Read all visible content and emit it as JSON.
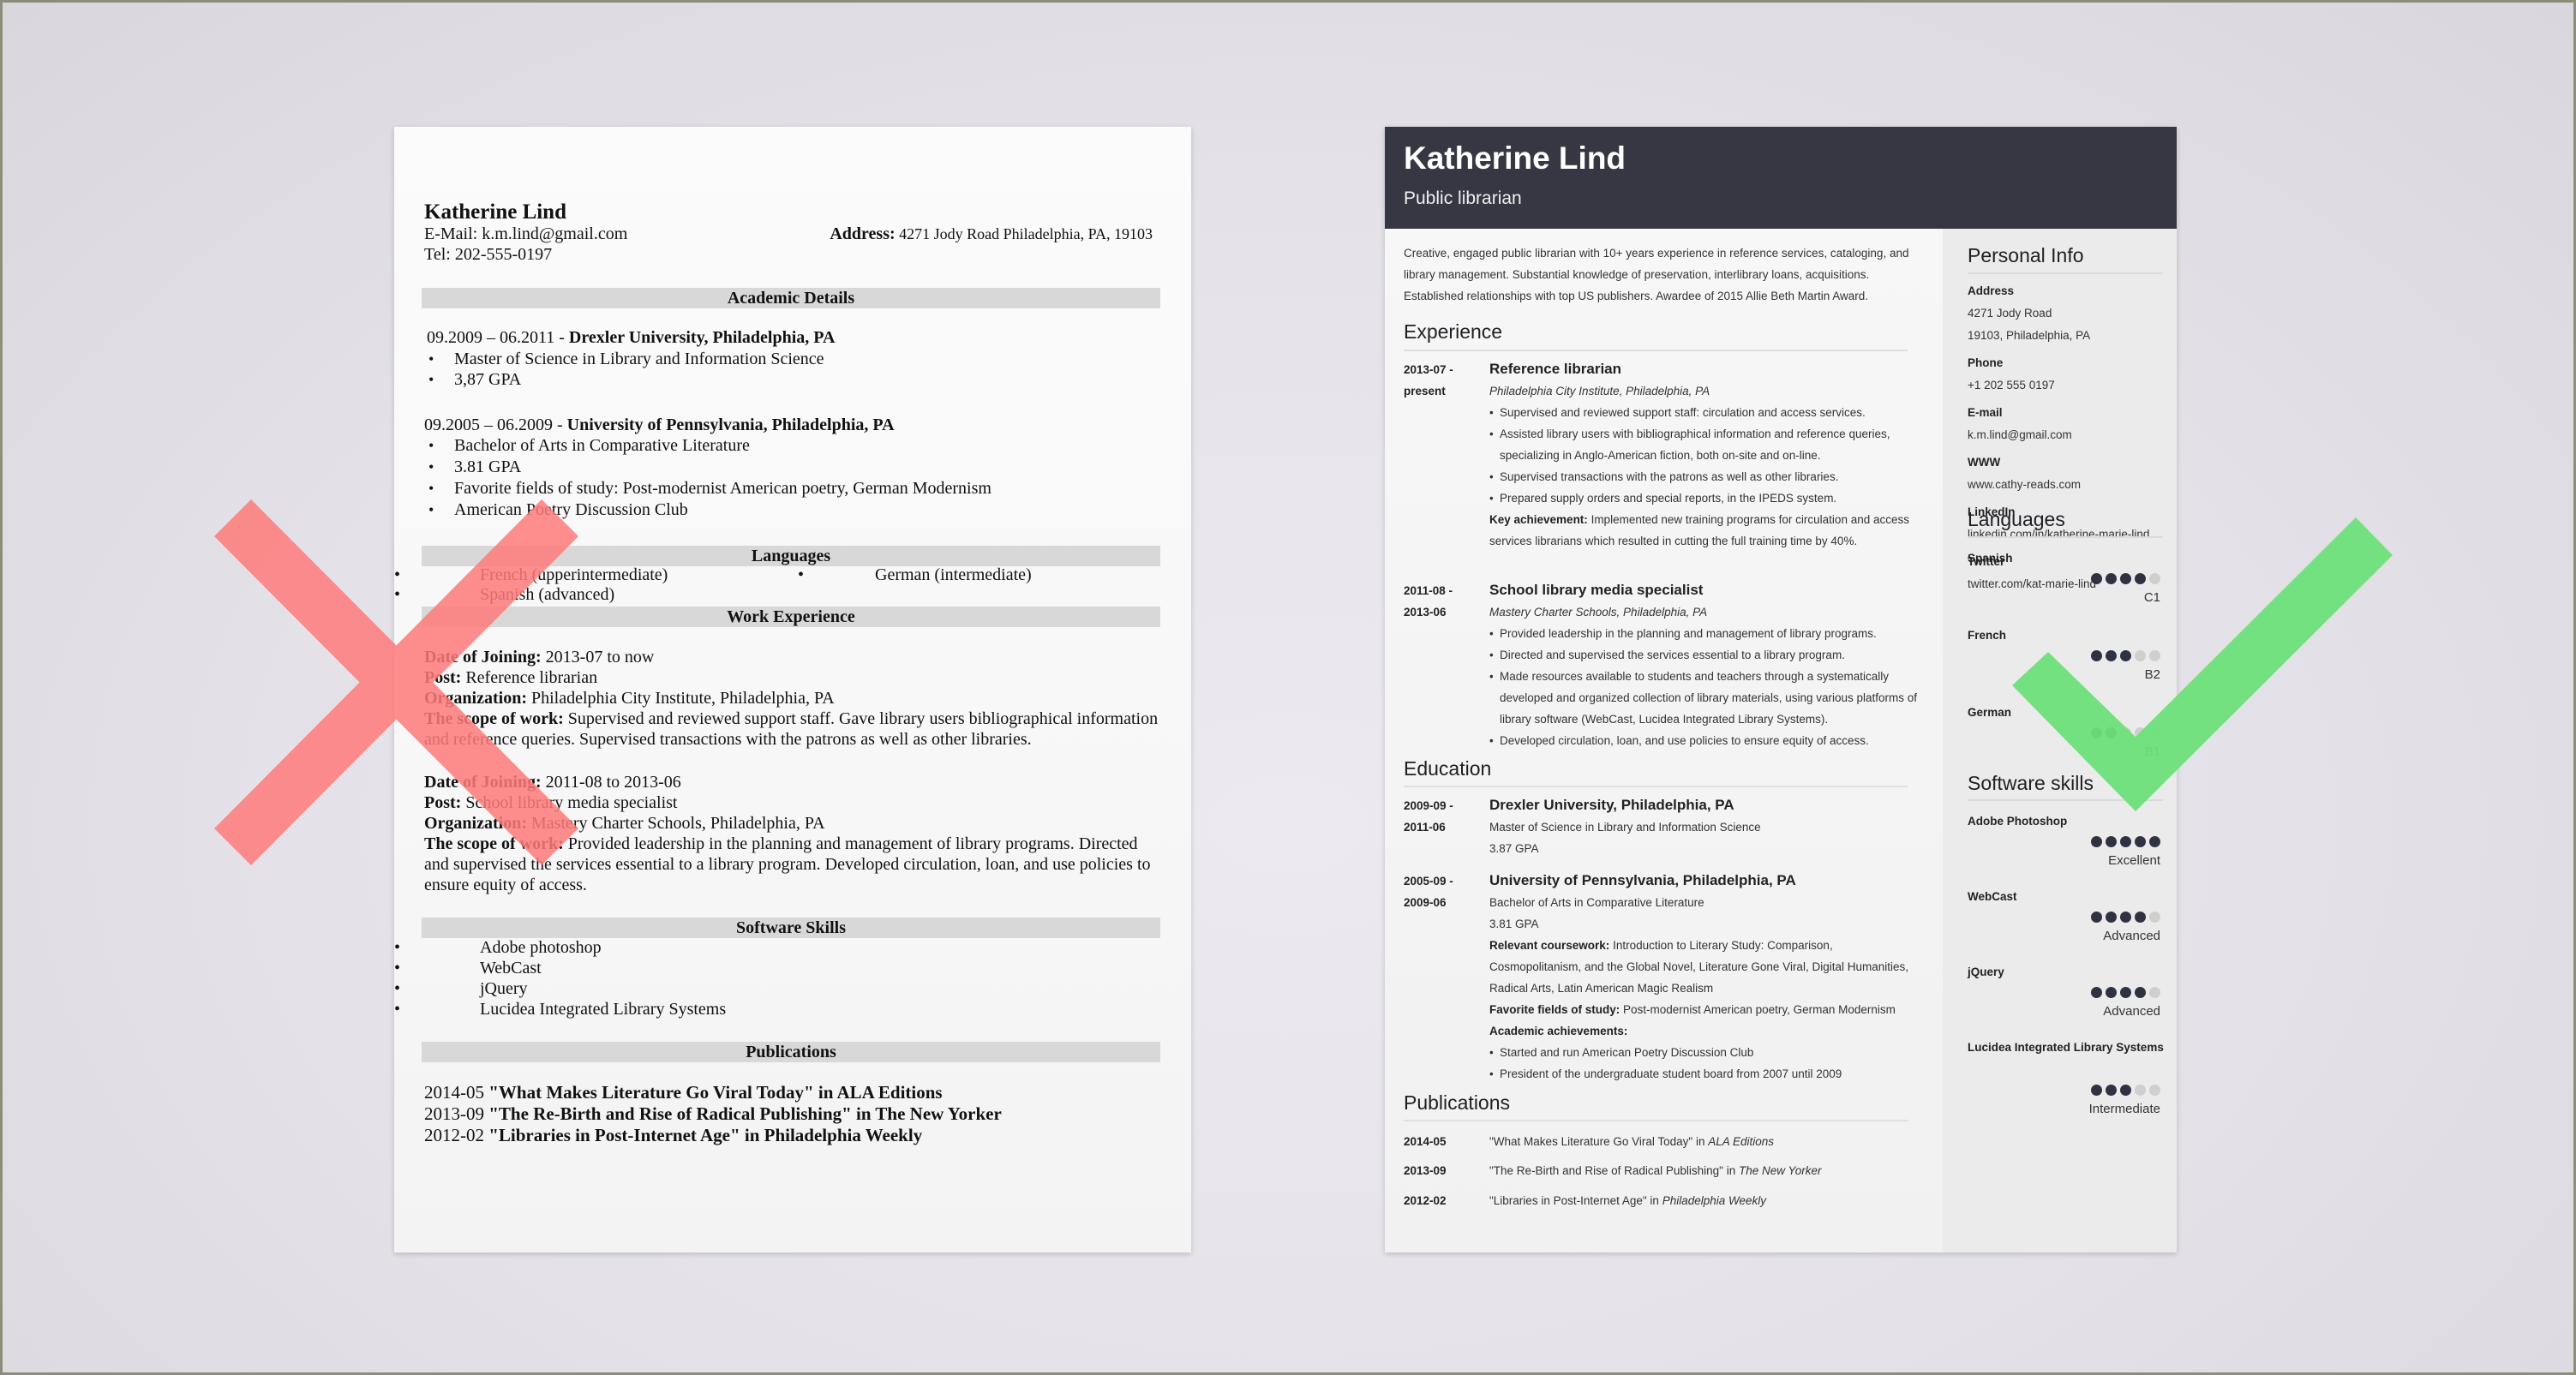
{
  "left_resume": {
    "name": "Katherine Lind",
    "email_label": "E-Mail:",
    "email": "k.m.lind@gmail.com",
    "address_label": "Address:",
    "address": "4271 Jody Road Philadelphia, PA, 19103",
    "tel_label": "Tel:",
    "tel": "202-555-0197",
    "sections": {
      "academic": "Academic Details",
      "languages": "Languages",
      "work": "Work Experience",
      "software": "Software Skills",
      "publications": "Publications"
    },
    "education": [
      {
        "dates": "09.2009 – 06.2011 - ",
        "school": "Drexler University, Philadelphia, PA",
        "items": [
          "Master of Science in Library and Information Science",
          "3,87 GPA"
        ]
      },
      {
        "dates": "09.2005 – 06.2009 - ",
        "school": "University of Pennsylvania, Philadelphia, PA",
        "items": [
          "Bachelor of Arts in Comparative Literature",
          "3.81 GPA",
          "Favorite fields of study: Post-modernist American poetry, German Modernism",
          "American Poetry Discussion Club"
        ]
      }
    ],
    "languages": [
      "French (upperintermediate)",
      "German (intermediate)",
      "Spanish (advanced)"
    ],
    "work": [
      {
        "date_label": "Date of Joining:",
        "date": " 2013-07 to now",
        "post_label": "Post:",
        "post": " Reference librarian",
        "org_label": "Organization:",
        "org": " Philadelphia City Institute, Philadelphia, PA",
        "scope_label": "The scope of work:",
        "scope": " Supervised and reviewed support staff. Gave library users bibliographical information and reference queries. Supervised transactions with the patrons as well as other libraries."
      },
      {
        "date_label": "Date of Joining:",
        "date": " 2011-08 to 2013-06",
        "post_label": "Post:",
        "post": " School library media specialist",
        "org_label": "Organization:",
        "org": " Mastery Charter Schools, Philadelphia, PA",
        "scope_label": "The scope of work:",
        "scope": " Provided leadership in the planning and management of library programs. Directed and supervised the services essential to a library program. Developed circulation, loan, and use policies to ensure equity of access."
      }
    ],
    "software": [
      "Adobe photoshop",
      "WebCast",
      "jQuery",
      "Lucidea Integrated Library Systems"
    ],
    "publications": [
      {
        "date": "2014-05 ",
        "title": "\"What Makes Literature Go Viral Today\" in ALA Editions"
      },
      {
        "date": "2013-09 ",
        "title": "\"The Re-Birth and Rise of Radical Publishing\" in The New Yorker"
      },
      {
        "date": "2012-02 ",
        "title": "\"Libraries in Post-Internet Age\" in Philadelphia Weekly"
      }
    ],
    "verdict_icon": "cross-icon",
    "verdict_color": "#ff7b7b"
  },
  "right_resume": {
    "name": "Katherine Lind",
    "title": "Public librarian",
    "header_color": "#363743",
    "summary": "Creative, engaged public librarian with 10+ years experience in reference services, cataloging, and library management. Substantial knowledge of preservation, interlibrary loans, acquisitions. Established relationships with top US publishers. Awardee of 2015 Allie Beth Martin Award.",
    "sections": {
      "experience": "Experience",
      "education": "Education",
      "publications": "Publications",
      "personal_info": "Personal Info",
      "languages": "Languages",
      "software": "Software skills"
    },
    "experience": [
      {
        "date_start": "2013-07 -",
        "date_end": "present",
        "title": "Reference librarian",
        "org": "Philadelphia City Institute, Philadelphia, PA",
        "bullets": [
          "Supervised and reviewed support staff: circulation and access services.",
          "Assisted library users with bibliographical information and reference queries, specializing in Anglo-American fiction, both on-site and on-line.",
          "Supervised transactions with the patrons as well as other libraries.",
          "Prepared supply orders and special reports, in the IPEDS system."
        ],
        "key_label": "Key achievement:",
        "key_text": " Implemented new training programs for circulation and access services librarians which resulted in cutting the full training time by 40%."
      },
      {
        "date_start": "2011-08 -",
        "date_end": "2013-06",
        "title": "School library media specialist",
        "org": "Mastery Charter Schools, Philadelphia, PA",
        "bullets": [
          "Provided leadership in the planning and management of library programs.",
          "Directed and supervised the services essential to a library program.",
          "Made resources available to students and teachers through a systematically developed and organized collection of library materials, using various platforms of library software (WebCast, Lucidea Integrated Library Systems).",
          "Developed circulation, loan, and use policies to ensure equity of access."
        ]
      }
    ],
    "education": [
      {
        "date_start": "2009-09 -",
        "date_end": "2011-06",
        "school": "Drexler University, Philadelphia, PA",
        "degree": "Master of Science in Library and Information Science",
        "gpa": "3.87 GPA"
      },
      {
        "date_start": "2005-09 -",
        "date_end": "2009-06",
        "school": "University of Pennsylvania, Philadelphia, PA",
        "degree": "Bachelor of Arts in Comparative Literature",
        "gpa": "3.81 GPA",
        "coursework_label": "Relevant coursework:",
        "coursework": " Introduction to Literary Study: Comparison, Cosmopolitanism, and the Global Novel, Literature Gone Viral, Digital Humanities, Radical Arts, Latin American Magic Realism",
        "fields_label": "Favorite fields of study:",
        "fields": " Post-modernist American poetry, German Modernism",
        "achievements_label": "Academic achievements:",
        "achievements": [
          "Started and run American Poetry Discussion Club",
          "President of the undergraduate student board from 2007 until 2009"
        ]
      }
    ],
    "publications": [
      {
        "date": "2014-05",
        "title": "\"What Makes Literature Go Viral Today\" in ",
        "outlet": "ALA Editions"
      },
      {
        "date": "2013-09",
        "title": "\"The Re-Birth and Rise of Radical Publishing\" in ",
        "outlet": "The New Yorker"
      },
      {
        "date": "2012-02",
        "title": "\"Libraries in Post-Internet Age\" in ",
        "outlet": "Philadelphia Weekly"
      }
    ],
    "personal_info": [
      {
        "label": "Address",
        "values": [
          "4271 Jody Road",
          "19103, Philadelphia, PA"
        ]
      },
      {
        "label": "Phone",
        "values": [
          "+1 202 555 0197"
        ]
      },
      {
        "label": "E-mail",
        "values": [
          "k.m.lind@gmail.com"
        ]
      },
      {
        "label": "WWW",
        "values": [
          "www.cathy-reads.com"
        ]
      },
      {
        "label": "LinkedIn",
        "values": [
          "linkedin.com/in/katherine-marie-lind"
        ]
      },
      {
        "label": "Twitter",
        "values": [
          "twitter.com/kat-marie-lind"
        ]
      }
    ],
    "languages": [
      {
        "name": "Spanish",
        "level": "C1",
        "rating": 4,
        "max": 5
      },
      {
        "name": "French",
        "level": "B2",
        "rating": 3,
        "max": 5
      },
      {
        "name": "German",
        "level": "B1",
        "rating": 2,
        "max": 5
      }
    ],
    "software": [
      {
        "name": "Adobe Photoshop",
        "level": "Excellent",
        "rating": 5,
        "max": 5
      },
      {
        "name": "WebCast",
        "level": "Advanced",
        "rating": 4,
        "max": 5
      },
      {
        "name": "jQuery",
        "level": "Advanced",
        "rating": 4,
        "max": 5
      },
      {
        "name": "Lucidea Integrated Library Systems",
        "level": "Intermediate",
        "rating": 3,
        "max": 5
      }
    ],
    "verdict_icon": "checkmark-icon",
    "verdict_color": "#6ee07a"
  }
}
